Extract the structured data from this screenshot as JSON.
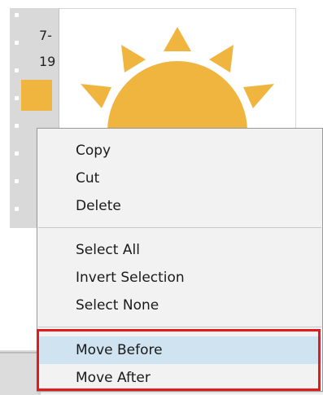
{
  "thumbnail_strip": {
    "frame_label_line1": "7-",
    "frame_label_line2": "19",
    "thumb_color": "#f0b53f"
  },
  "preview": {
    "image": "sun-icon",
    "sun_color": "#f0b53f"
  },
  "context_menu": {
    "groups": [
      [
        "Copy",
        "Cut",
        "Delete"
      ],
      [
        "Select All",
        "Invert Selection",
        "Select None"
      ],
      [
        "Move Before",
        "Move After"
      ]
    ],
    "hovered_item": "Move Before"
  },
  "annotation": {
    "highlight_color": "#e21c1c"
  }
}
